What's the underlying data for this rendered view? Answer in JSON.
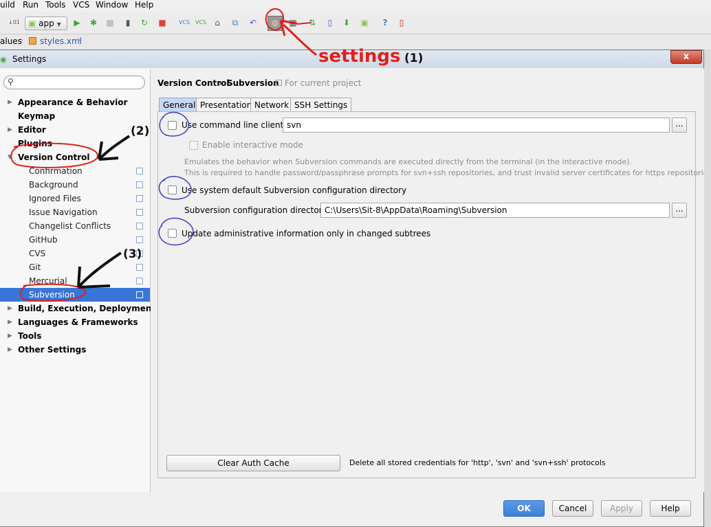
{
  "menubar": {
    "items": [
      {
        "label": "uild"
      },
      {
        "label": "Run"
      },
      {
        "label": "Tools"
      },
      {
        "label": "VCS"
      },
      {
        "label": "Window"
      },
      {
        "label": "Help"
      }
    ]
  },
  "toolbar": {
    "run_config": "app",
    "icons": [
      "make-icon",
      "run-icon",
      "debug-icon",
      "attach-debugger-icon",
      "device-monitor-icon",
      "sync-icon",
      "stop-icon",
      "vcs-update-icon",
      "vcs-commit-icon",
      "history-icon",
      "compare-icon",
      "revert-icon",
      "settings-icon",
      "project-structure-icon",
      "sync-gradle-icon",
      "avd-manager-icon",
      "sdk-manager-icon",
      "android-icon",
      "help-icon",
      "device-icon"
    ]
  },
  "editor_tabs": {
    "breadcrumb": "alues",
    "file_tab": "styles.xml"
  },
  "dialog": {
    "title": "Settings",
    "close_label": "x",
    "search": {
      "placeholder": ""
    },
    "tree": [
      {
        "label": "Appearance & Behavior",
        "expandable": true
      },
      {
        "label": "Keymap",
        "expandable": false
      },
      {
        "label": "Editor",
        "expandable": true
      },
      {
        "label": "Plugins",
        "expandable": false
      },
      {
        "label": "Version Control",
        "expandable": true,
        "expanded": true
      }
    ],
    "vc_children": [
      "Confirmation",
      "Background",
      "Ignored Files",
      "Issue Navigation",
      "Changelist Conflicts",
      "GitHub",
      "CVS",
      "Git",
      "Mercurial",
      "Subversion"
    ],
    "selected": "Subversion",
    "tree_after": [
      {
        "label": "Build, Execution, Deployment",
        "expandable": true
      },
      {
        "label": "Languages & Frameworks",
        "expandable": true
      },
      {
        "label": "Tools",
        "expandable": true
      },
      {
        "label": "Other Settings",
        "expandable": true
      }
    ],
    "breadcrumb": {
      "parent": "Version Control",
      "separator": "›",
      "current": "Subversion",
      "scope": "For current project"
    },
    "tabs": [
      "General",
      "Presentation",
      "Network",
      "SSH Settings"
    ],
    "active_tab": "General",
    "general": {
      "use_cmd_client": {
        "label": "Use command line client:",
        "checked": false,
        "value": "svn"
      },
      "interactive_mode": {
        "label": "Enable interactive mode",
        "checked": false,
        "enabled": false
      },
      "description_1": "Emulates the behavior when Subversion commands are executed directly from the terminal (in the interactive mode).",
      "description_2": "This is required to handle password/passphrase prompts for svn+ssh repositories, and trust invalid server certificates for https repositories.",
      "use_default_config": {
        "label": "Use system default Subversion configuration directory",
        "checked": false
      },
      "config_dir": {
        "label": "Subversion configuration directory:",
        "value": "C:\\Users\\Sit-8\\AppData\\Roaming\\Subversion"
      },
      "update_admin": {
        "label": "Update administrative information only in changed subtrees",
        "checked": false
      },
      "browse_label": "...",
      "clear_cache": {
        "label": "Clear Auth Cache",
        "note": "Delete all stored credentials for 'http', 'svn' and 'svn+ssh' protocols"
      }
    },
    "buttons": {
      "ok": "OK",
      "cancel": "Cancel",
      "apply": "Apply",
      "help": "Help"
    }
  },
  "annotations": {
    "settings_label": "settings",
    "step1": "(1)",
    "step2": "(2)",
    "step3": "(3)"
  }
}
